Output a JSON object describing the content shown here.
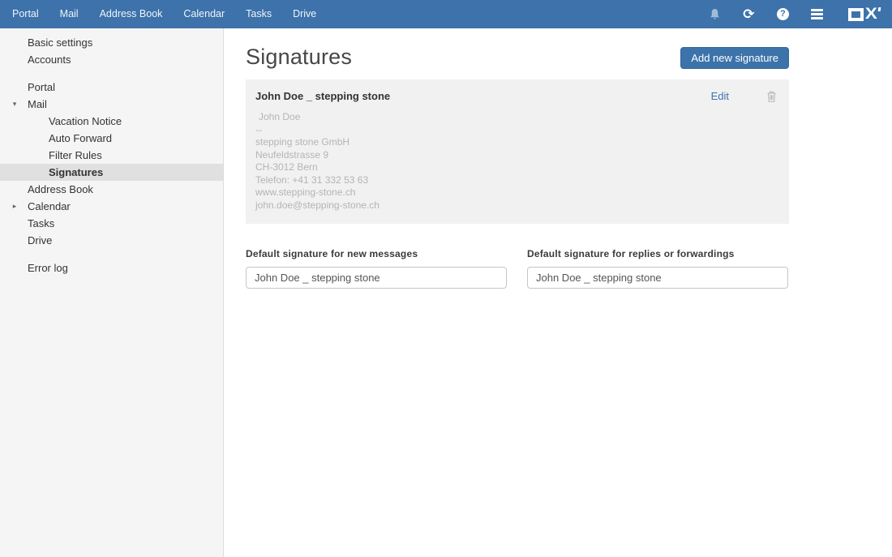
{
  "colors": {
    "topbar_bg": "#3d72ab",
    "accent_blue": "#3c73aa",
    "sidebar_bg": "#f5f5f5",
    "selected_item_bg": "#e0e0e0",
    "card_bg": "#f1f1f1",
    "muted_text": "#b4b4b4"
  },
  "topbar": {
    "apps": [
      "Portal",
      "Mail",
      "Address Book",
      "Calendar",
      "Tasks",
      "Drive"
    ],
    "icons": [
      "notifications-icon",
      "refresh-icon",
      "help-icon",
      "menu-icon"
    ],
    "logo": "OX"
  },
  "sidebar": {
    "items": [
      {
        "label": "Basic settings"
      },
      {
        "label": "Accounts"
      },
      {
        "label": "Portal"
      },
      {
        "label": "Mail",
        "caret": "down"
      },
      {
        "label": "Vacation Notice"
      },
      {
        "label": "Auto Forward"
      },
      {
        "label": "Filter Rules"
      },
      {
        "label": "Signatures",
        "selected": true
      },
      {
        "label": "Address Book"
      },
      {
        "label": "Calendar",
        "caret": "right"
      },
      {
        "label": "Tasks"
      },
      {
        "label": "Drive"
      },
      {
        "label": "Error log"
      }
    ],
    "caret_down": "▾",
    "caret_right": "▸"
  },
  "main": {
    "title": "Signatures",
    "add_button": "Add new signature",
    "signature": {
      "name": "John Doe _ stepping stone",
      "edit_label": "Edit",
      "lines": [
        "John Doe",
        "--",
        "stepping stone GmbH",
        "Neufeldstrasse 9",
        "CH-3012 Bern",
        "Telefon: +41 31 332 53 63",
        "www.stepping-stone.ch",
        "john.doe@stepping-stone.ch"
      ]
    },
    "defaults": {
      "new_label": "Default signature for new messages",
      "new_value": "John Doe _ stepping stone",
      "reply_label": "Default signature for replies or forwardings",
      "reply_value": "John Doe _ stepping stone"
    }
  }
}
